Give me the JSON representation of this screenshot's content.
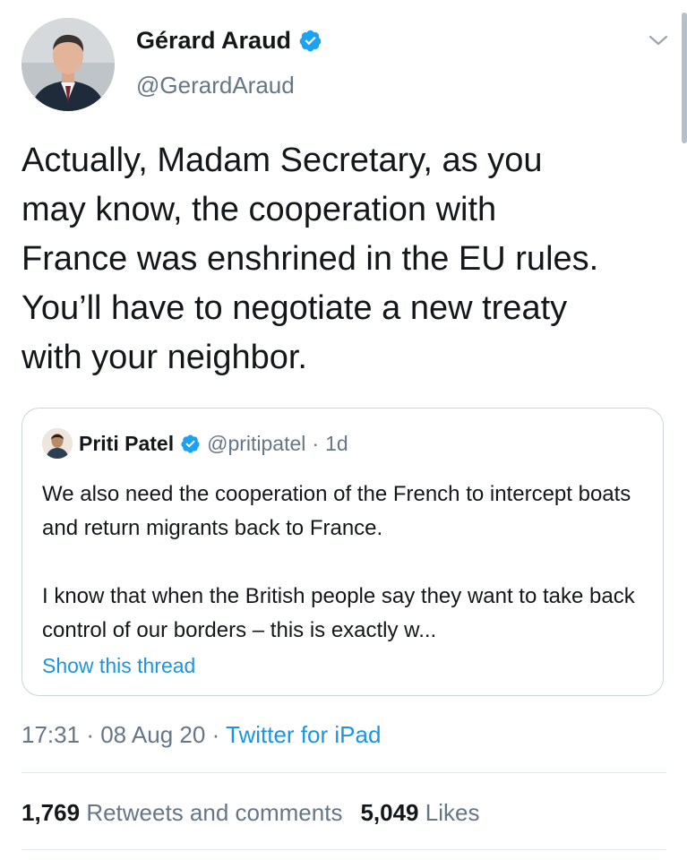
{
  "author": {
    "display_name": "Gérard Araud",
    "handle": "@GerardAraud",
    "verified_icon": "verified-badge-icon"
  },
  "tweet": {
    "text": "Actually, Madam Secretary, as you\nmay know, the cooperation with\nFrance was enshrined in the EU rules.\nYou’ll have to negotiate a new treaty\nwith your neighbor."
  },
  "quoted_tweet": {
    "display_name": "Priti Patel",
    "handle": "@pritipatel",
    "separator": "·",
    "age": "1d",
    "paragraph_1": "We also need the cooperation of the French to intercept boats and return migrants back to France.",
    "paragraph_2": "I know that when the British people say they want to take back control of our borders – this is exactly w...",
    "show_thread_label": "Show this thread"
  },
  "meta": {
    "time": "17:31",
    "separator": "·",
    "date": "08 Aug 20",
    "source": "Twitter for iPad"
  },
  "stats": {
    "retweets_count": "1,769",
    "retweets_label": "Retweets and comments",
    "likes_count": "5,049",
    "likes_label": "Likes"
  },
  "colors": {
    "link_blue": "#1b95e0",
    "muted_gray": "#657786",
    "text_dark": "#14171a",
    "border": "#ccd6dd"
  }
}
